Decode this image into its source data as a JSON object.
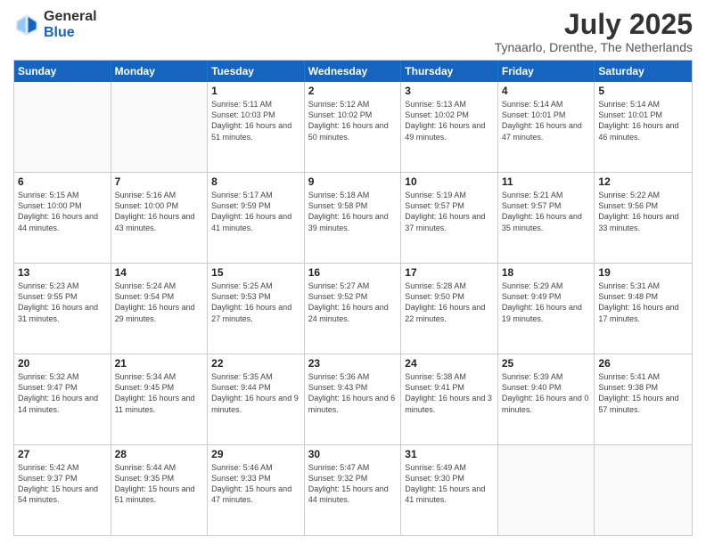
{
  "logo": {
    "general": "General",
    "blue": "Blue"
  },
  "title": "July 2025",
  "location": "Tynaarlo, Drenthe, The Netherlands",
  "days": [
    "Sunday",
    "Monday",
    "Tuesday",
    "Wednesday",
    "Thursday",
    "Friday",
    "Saturday"
  ],
  "weeks": [
    [
      {
        "day": "",
        "content": ""
      },
      {
        "day": "",
        "content": ""
      },
      {
        "day": "1",
        "content": "Sunrise: 5:11 AM\nSunset: 10:03 PM\nDaylight: 16 hours and 51 minutes."
      },
      {
        "day": "2",
        "content": "Sunrise: 5:12 AM\nSunset: 10:02 PM\nDaylight: 16 hours and 50 minutes."
      },
      {
        "day": "3",
        "content": "Sunrise: 5:13 AM\nSunset: 10:02 PM\nDaylight: 16 hours and 49 minutes."
      },
      {
        "day": "4",
        "content": "Sunrise: 5:14 AM\nSunset: 10:01 PM\nDaylight: 16 hours and 47 minutes."
      },
      {
        "day": "5",
        "content": "Sunrise: 5:14 AM\nSunset: 10:01 PM\nDaylight: 16 hours and 46 minutes."
      }
    ],
    [
      {
        "day": "6",
        "content": "Sunrise: 5:15 AM\nSunset: 10:00 PM\nDaylight: 16 hours and 44 minutes."
      },
      {
        "day": "7",
        "content": "Sunrise: 5:16 AM\nSunset: 10:00 PM\nDaylight: 16 hours and 43 minutes."
      },
      {
        "day": "8",
        "content": "Sunrise: 5:17 AM\nSunset: 9:59 PM\nDaylight: 16 hours and 41 minutes."
      },
      {
        "day": "9",
        "content": "Sunrise: 5:18 AM\nSunset: 9:58 PM\nDaylight: 16 hours and 39 minutes."
      },
      {
        "day": "10",
        "content": "Sunrise: 5:19 AM\nSunset: 9:57 PM\nDaylight: 16 hours and 37 minutes."
      },
      {
        "day": "11",
        "content": "Sunrise: 5:21 AM\nSunset: 9:57 PM\nDaylight: 16 hours and 35 minutes."
      },
      {
        "day": "12",
        "content": "Sunrise: 5:22 AM\nSunset: 9:56 PM\nDaylight: 16 hours and 33 minutes."
      }
    ],
    [
      {
        "day": "13",
        "content": "Sunrise: 5:23 AM\nSunset: 9:55 PM\nDaylight: 16 hours and 31 minutes."
      },
      {
        "day": "14",
        "content": "Sunrise: 5:24 AM\nSunset: 9:54 PM\nDaylight: 16 hours and 29 minutes."
      },
      {
        "day": "15",
        "content": "Sunrise: 5:25 AM\nSunset: 9:53 PM\nDaylight: 16 hours and 27 minutes."
      },
      {
        "day": "16",
        "content": "Sunrise: 5:27 AM\nSunset: 9:52 PM\nDaylight: 16 hours and 24 minutes."
      },
      {
        "day": "17",
        "content": "Sunrise: 5:28 AM\nSunset: 9:50 PM\nDaylight: 16 hours and 22 minutes."
      },
      {
        "day": "18",
        "content": "Sunrise: 5:29 AM\nSunset: 9:49 PM\nDaylight: 16 hours and 19 minutes."
      },
      {
        "day": "19",
        "content": "Sunrise: 5:31 AM\nSunset: 9:48 PM\nDaylight: 16 hours and 17 minutes."
      }
    ],
    [
      {
        "day": "20",
        "content": "Sunrise: 5:32 AM\nSunset: 9:47 PM\nDaylight: 16 hours and 14 minutes."
      },
      {
        "day": "21",
        "content": "Sunrise: 5:34 AM\nSunset: 9:45 PM\nDaylight: 16 hours and 11 minutes."
      },
      {
        "day": "22",
        "content": "Sunrise: 5:35 AM\nSunset: 9:44 PM\nDaylight: 16 hours and 9 minutes."
      },
      {
        "day": "23",
        "content": "Sunrise: 5:36 AM\nSunset: 9:43 PM\nDaylight: 16 hours and 6 minutes."
      },
      {
        "day": "24",
        "content": "Sunrise: 5:38 AM\nSunset: 9:41 PM\nDaylight: 16 hours and 3 minutes."
      },
      {
        "day": "25",
        "content": "Sunrise: 5:39 AM\nSunset: 9:40 PM\nDaylight: 16 hours and 0 minutes."
      },
      {
        "day": "26",
        "content": "Sunrise: 5:41 AM\nSunset: 9:38 PM\nDaylight: 15 hours and 57 minutes."
      }
    ],
    [
      {
        "day": "27",
        "content": "Sunrise: 5:42 AM\nSunset: 9:37 PM\nDaylight: 15 hours and 54 minutes."
      },
      {
        "day": "28",
        "content": "Sunrise: 5:44 AM\nSunset: 9:35 PM\nDaylight: 15 hours and 51 minutes."
      },
      {
        "day": "29",
        "content": "Sunrise: 5:46 AM\nSunset: 9:33 PM\nDaylight: 15 hours and 47 minutes."
      },
      {
        "day": "30",
        "content": "Sunrise: 5:47 AM\nSunset: 9:32 PM\nDaylight: 15 hours and 44 minutes."
      },
      {
        "day": "31",
        "content": "Sunrise: 5:49 AM\nSunset: 9:30 PM\nDaylight: 15 hours and 41 minutes."
      },
      {
        "day": "",
        "content": ""
      },
      {
        "day": "",
        "content": ""
      }
    ]
  ]
}
